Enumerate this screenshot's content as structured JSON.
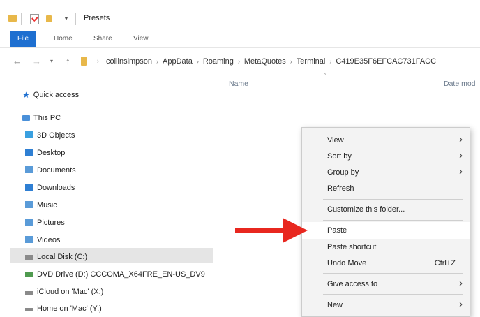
{
  "window": {
    "title": "Presets"
  },
  "ribbon": {
    "tabs": [
      "File",
      "Home",
      "Share",
      "View"
    ]
  },
  "address": {
    "breadcrumbs": [
      "collinsimpson",
      "AppData",
      "Roaming",
      "MetaQuotes",
      "Terminal",
      "C419E35F6EFCAC731FACC"
    ]
  },
  "nav": {
    "quick_access": "Quick access",
    "this_pc": "This PC",
    "items": [
      "3D Objects",
      "Desktop",
      "Documents",
      "Downloads",
      "Music",
      "Pictures",
      "Videos",
      "Local Disk (C:)",
      "DVD Drive (D:) CCCOMA_X64FRE_EN-US_DV9",
      "iCloud on 'Mac' (X:)",
      "Home on 'Mac' (Y:)"
    ]
  },
  "columns": {
    "name": "Name",
    "date": "Date mod"
  },
  "menu": {
    "view": "View",
    "sort_by": "Sort by",
    "group_by": "Group by",
    "refresh": "Refresh",
    "customize": "Customize this folder...",
    "paste": "Paste",
    "paste_shortcut": "Paste shortcut",
    "undo_move": "Undo Move",
    "undo_shortcut": "Ctrl+Z",
    "give_access": "Give access to",
    "new": "New"
  },
  "colors": {
    "accent": "#1e6fd0",
    "arrow": "#e8271f",
    "folder": "#e8b84a"
  }
}
